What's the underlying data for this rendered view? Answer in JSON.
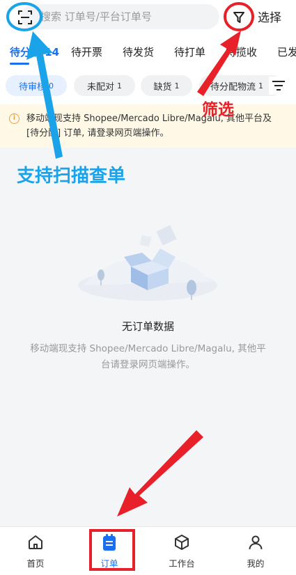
{
  "header": {
    "search_placeholder": "搜索 订单号/平台订单号",
    "select_label": "选择"
  },
  "tabs": [
    {
      "label": "待分配 14",
      "active": true
    },
    {
      "label": "待开票",
      "active": false
    },
    {
      "label": "待发货",
      "active": false
    },
    {
      "label": "待打单",
      "active": false
    },
    {
      "label": "待揽收",
      "active": false
    },
    {
      "label": "已发",
      "active": false
    }
  ],
  "chips": [
    {
      "label": "待审核",
      "count": "0",
      "active": true
    },
    {
      "label": "未配对",
      "count": "1",
      "active": false
    },
    {
      "label": "缺货",
      "count": "1",
      "active": false
    },
    {
      "label": "待分配物流",
      "count": "1",
      "active": false
    }
  ],
  "notice": {
    "text": "移动端现支持 Shopee/Mercado Libre/Magalu, 其他平台及 [待分配] 订单, 请登录网页端操作。"
  },
  "empty": {
    "title": "无订单数据",
    "description": "移动端现支持 Shopee/Mercado Libre/Magalu, 其他平台请登录网页端操作。"
  },
  "annotations": {
    "scan_label": "支持扫描查单",
    "filter_label": "筛选",
    "blue": "#1aa3e8",
    "red": "#e8202a"
  },
  "bottom_nav": [
    {
      "label": "首页",
      "icon": "home-icon",
      "active": false
    },
    {
      "label": "订单",
      "icon": "order-icon",
      "active": true
    },
    {
      "label": "工作台",
      "icon": "workbench-icon",
      "active": false
    },
    {
      "label": "我的",
      "icon": "profile-icon",
      "active": false
    }
  ],
  "colors": {
    "accent": "#1a6ff0",
    "notice_bg": "#fff8e6",
    "notice_icon": "#e6a23c"
  }
}
